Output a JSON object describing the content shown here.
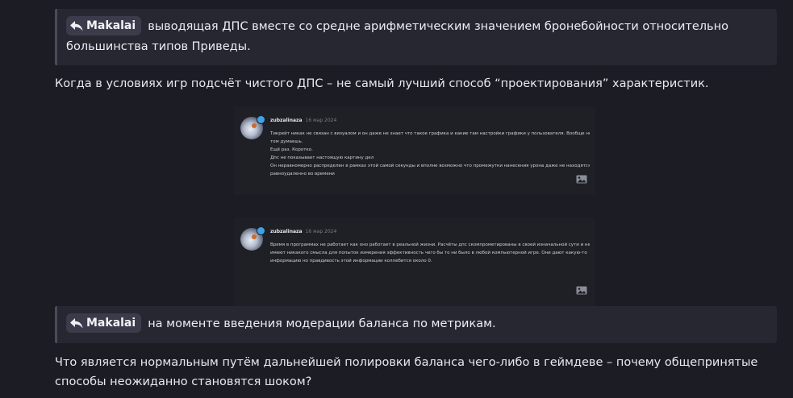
{
  "quote1": {
    "mention": "Makalai",
    "text": "выводящая ДПС вместе со средне арифметическим значением бронебойности относительно большинства типов Приведы."
  },
  "paragraph1": "Когда в условиях игр подсчёт чистого ДПС – не самый лучший способ “проектирования” характеристик.",
  "screenshot1": {
    "author": "zubzalinaza",
    "date": "16 мар 2024",
    "lines": [
      "Тикрейт никак не связан с визуалом и он даже не знает что такое графика и какие там настройки графики у пользователя. Вообще не о",
      "том думаешь.",
      "Ещё раз. Коротко.",
      "Дпс не показывает настоящую картину дел",
      "Он неравномерно распределен в рамках этой самой секунды и вполне возможно что промежутки нанесения урона даже не находятся",
      "равноудаленно во времени"
    ]
  },
  "screenshot2": {
    "author": "zubzalinaza",
    "date": "16 мар 2024",
    "lines": [
      "Время в программах не работает как оно работает в реальной жизни. Расчёты дпс скомпрометированы в своей изначальной сути и не",
      "имеют никакого смысла для попыток измерения эффективность чего бы то ни было в любой компьютерной игре. Они дают какую-то",
      "информацию но правдивость этой информации коллебится около 0."
    ]
  },
  "quote2": {
    "mention": "Makalai",
    "text": "на моменте введения модерации баланса по метрикам."
  },
  "paragraph2": "Что является нормальным путём дальнейшей полировки баланса чего-либо в геймдеве – почему общепринятые способы неожиданно становятся шоком?",
  "colors": {
    "background": "#1c1d24",
    "quote_background": "#262731",
    "mention_background": "#3a3c4b",
    "badge": "#3ea2e8"
  }
}
